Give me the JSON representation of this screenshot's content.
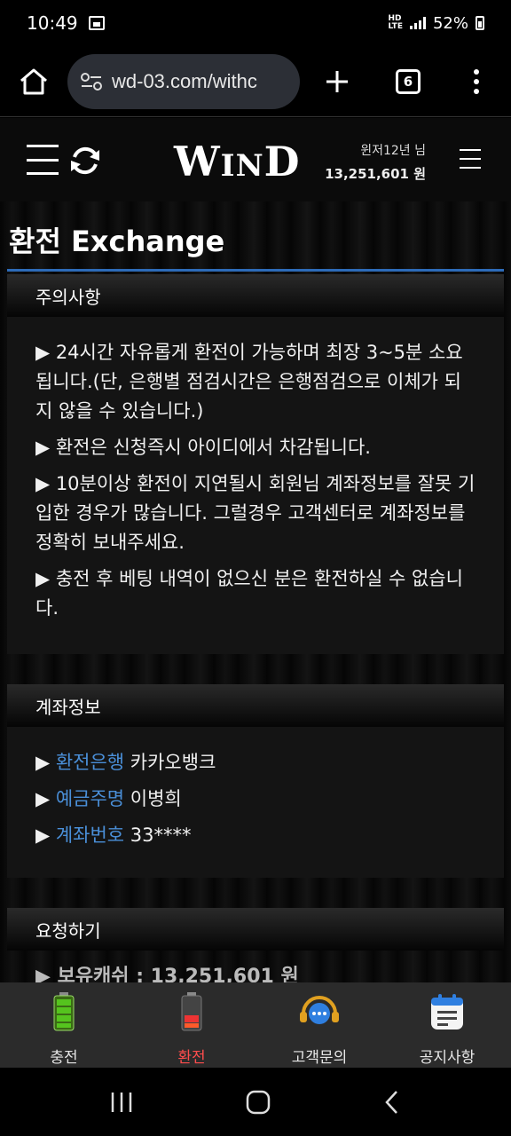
{
  "status": {
    "time": "10:49",
    "network_top": "HD",
    "network_bottom": "LTE",
    "battery": "52%"
  },
  "browser": {
    "url": "wd-03.com/withc",
    "tab_count": "6"
  },
  "header": {
    "logo_main": "WinD",
    "logo_prefix": "W",
    "logo_mid": "IN",
    "logo_end": "D",
    "user_name": "윈저12년 님",
    "user_balance": "13,251,601 원"
  },
  "page": {
    "title": "환전 Exchange"
  },
  "notice": {
    "heading": "주의사항",
    "lines": [
      "▶ 24시간 자유롭게 환전이 가능하며 최장 3~5분 소요됩니다.(단, 은행별 점검시간은 은행점검으로 이체가 되지 않을 수 있습니다.)",
      "▶ 환전은 신청즉시 아이디에서 차감됩니다.",
      "▶ 10분이상 환전이 지연될시 회원님 계좌정보를 잘못 기입한 경우가 많습니다. 그럴경우 고객센터로 계좌정보를 정확히 보내주세요.",
      "▶ 충전 후 베팅 내역이 없으신 분은 환전하실 수 없습니다."
    ]
  },
  "account": {
    "heading": "계좌정보",
    "rows": [
      {
        "label": "환전은행",
        "value": "카카오뱅크"
      },
      {
        "label": "예금주명",
        "value": "이병희"
      },
      {
        "label": "계좌번호",
        "value": "33****"
      }
    ]
  },
  "request": {
    "heading": "요청하기",
    "cash_line": "▶ 보유캐쉬 : 13,251,601 원"
  },
  "bottom_nav": [
    {
      "label": "충전",
      "icon": "battery-full-icon"
    },
    {
      "label": "환전",
      "icon": "battery-low-icon",
      "active": true
    },
    {
      "label": "고객문의",
      "icon": "headset-chat-icon"
    },
    {
      "label": "공지사항",
      "icon": "notepad-icon"
    }
  ],
  "colors": {
    "accent_blue": "#2d6bb8",
    "label_blue": "#4a8fd8",
    "active_red": "#ff4d4d",
    "battery_green": "#55c41e"
  }
}
